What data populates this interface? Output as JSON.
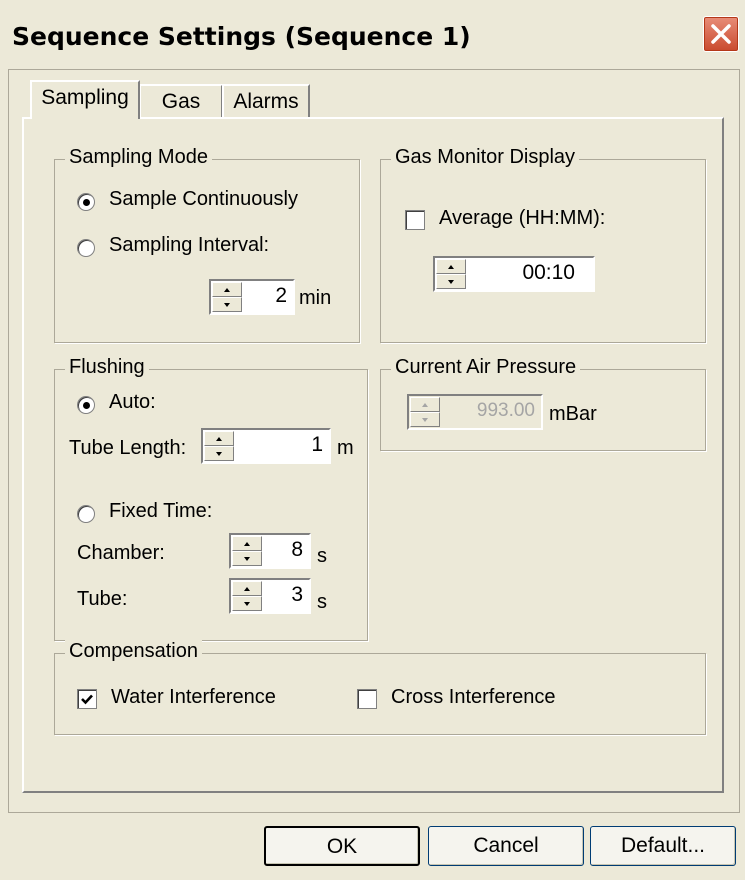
{
  "window": {
    "title": "Sequence Settings (Sequence 1)"
  },
  "tabs": [
    {
      "label": "Sampling"
    },
    {
      "label": "Gas"
    },
    {
      "label": "Alarms"
    }
  ],
  "sampling_mode": {
    "title": "Sampling Mode",
    "option_continuous": "Sample Continuously",
    "option_interval": "Sampling Interval:",
    "selected": "continuous",
    "interval_value": "2",
    "interval_unit": "min"
  },
  "gas_monitor": {
    "title": "Gas Monitor Display",
    "average_label": "Average (HH:MM):",
    "average_checked": false,
    "average_value": "00:10"
  },
  "flushing": {
    "title": "Flushing",
    "auto_label": "Auto:",
    "selected": "auto",
    "tube_length_label": "Tube Length:",
    "tube_length_value": "1",
    "tube_length_unit": "m",
    "fixed_time_label": "Fixed Time:",
    "chamber_label": "Chamber:",
    "chamber_value": "8",
    "chamber_unit": "s",
    "tube_label": "Tube:",
    "tube_value": "3",
    "tube_unit": "s"
  },
  "air_pressure": {
    "title": "Current Air Pressure",
    "value": "993.00",
    "unit": "mBar"
  },
  "compensation": {
    "title": "Compensation",
    "water_label": "Water Interference",
    "water_checked": true,
    "cross_label": "Cross Interference",
    "cross_checked": false
  },
  "buttons": {
    "ok": "OK",
    "cancel": "Cancel",
    "default": "Default..."
  }
}
